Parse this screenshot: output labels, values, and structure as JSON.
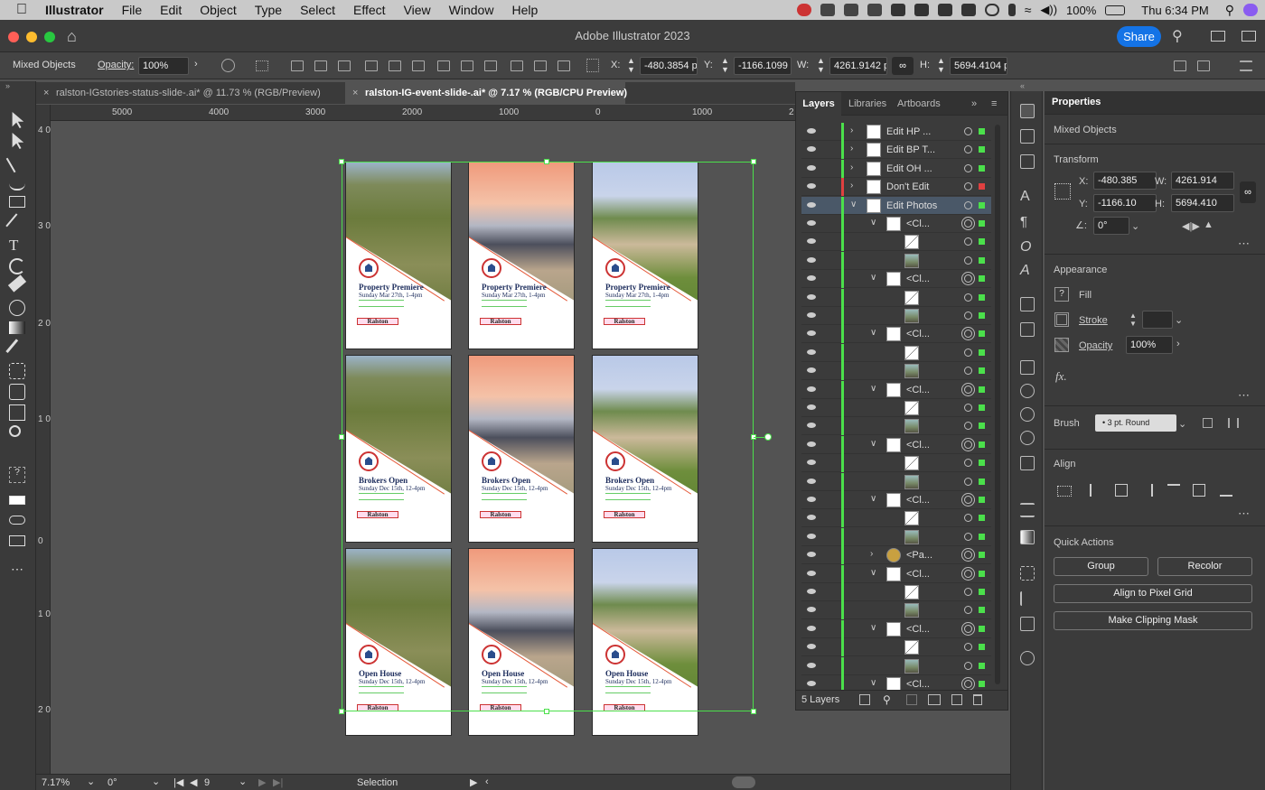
{
  "menubar": {
    "app": "Illustrator",
    "items": [
      "File",
      "Edit",
      "Object",
      "Type",
      "Select",
      "Effect",
      "View",
      "Window",
      "Help"
    ],
    "battery": "100%",
    "clock": "Thu 6:34 PM"
  },
  "window": {
    "title": "Adobe Illustrator 2023",
    "share": "Share"
  },
  "control": {
    "selection_type": "Mixed Objects",
    "opacity_label": "Opacity:",
    "opacity": "100%",
    "x_label": "X:",
    "x": "-480.3854 p",
    "y_label": "Y:",
    "y": "-1166.1099",
    "w_label": "W:",
    "w": "4261.9142 p",
    "h_label": "H:",
    "h": "5694.4104 p"
  },
  "tabs": [
    {
      "label": "ralston-IGstories-status-slide-.ai* @ 11.73 % (RGB/Preview)"
    },
    {
      "label": "ralston-IG-event-slide-.ai* @ 7.17 % (RGB/CPU Preview)"
    }
  ],
  "ruler": {
    "top": [
      "5000",
      "4000",
      "3000",
      "2000",
      "1000",
      "0",
      "1000",
      "2"
    ],
    "left": [
      "4 0 0",
      "3 0 0 0",
      "2 0 0 0",
      "1 0 0 0",
      "0",
      "1 0 0 0",
      "2 0 0 0"
    ]
  },
  "artboards": [
    {
      "title": "Property Premiere",
      "date": "Sunday Mar 27th, 1-4pm",
      "logo": "Ralston",
      "scene": "aerial"
    },
    {
      "title": "Property Premiere",
      "date": "Sunday Mar 27th, 1-4pm",
      "logo": "Ralston",
      "scene": "sunset"
    },
    {
      "title": "Property Premiere",
      "date": "Sunday Mar 27th, 1-4pm",
      "logo": "Ralston",
      "scene": "day"
    },
    {
      "title": "Brokers Open",
      "date": "Sunday Dec 15th, 12-4pm",
      "logo": "Ralston",
      "scene": "aerial"
    },
    {
      "title": "Brokers Open",
      "date": "Sunday Dec 15th, 12-4pm",
      "logo": "Ralston",
      "scene": "sunset"
    },
    {
      "title": "Brokers Open",
      "date": "Sunday Dec 15th, 12-4pm",
      "logo": "Ralston",
      "scene": "day"
    },
    {
      "title": "Open House",
      "date": "Sunday Dec 15th, 12-4pm",
      "logo": "Ralston",
      "scene": "aerial"
    },
    {
      "title": "Open House",
      "date": "Sunday Dec 15th, 12-4pm",
      "logo": "Ralston",
      "scene": "sunset"
    },
    {
      "title": "Open House",
      "date": "Sunday Dec 15th, 12-4pm",
      "logo": "Ralston",
      "scene": "day"
    }
  ],
  "layers_panel": {
    "tabs": [
      "Layers",
      "Libraries",
      "Artboards"
    ],
    "rows": [
      {
        "name": "Edit HP ...",
        "level": 0,
        "color": "#4be04b",
        "thumb": "doc"
      },
      {
        "name": "Edit BP T...",
        "level": 0,
        "color": "#4be04b",
        "thumb": "doc"
      },
      {
        "name": "Edit OH ...",
        "level": 0,
        "color": "#4be04b",
        "thumb": "doc"
      },
      {
        "name": "Don't Edit",
        "level": 0,
        "color": "#e04040",
        "thumb": "doc"
      },
      {
        "name": "Edit Photos",
        "level": 0,
        "color": "#4be04b",
        "thumb": "doc",
        "expanded": true,
        "selected": true
      },
      {
        "name": "<Cl...",
        "level": 1,
        "color": "#4be04b",
        "thumb": "clip",
        "expanded": true
      },
      {
        "name": "",
        "level": 2,
        "color": "#4be04b",
        "thumb": "path"
      },
      {
        "name": "",
        "level": 2,
        "color": "#4be04b",
        "thumb": "img"
      },
      {
        "name": "<Cl...",
        "level": 1,
        "color": "#4be04b",
        "thumb": "clip",
        "expanded": true
      },
      {
        "name": "",
        "level": 2,
        "color": "#4be04b",
        "thumb": "path"
      },
      {
        "name": "",
        "level": 2,
        "color": "#4be04b",
        "thumb": "img"
      },
      {
        "name": "<Cl...",
        "level": 1,
        "color": "#4be04b",
        "thumb": "clip",
        "expanded": true
      },
      {
        "name": "",
        "level": 2,
        "color": "#4be04b",
        "thumb": "path"
      },
      {
        "name": "",
        "level": 2,
        "color": "#4be04b",
        "thumb": "img"
      },
      {
        "name": "<Cl...",
        "level": 1,
        "color": "#4be04b",
        "thumb": "clip",
        "expanded": true
      },
      {
        "name": "",
        "level": 2,
        "color": "#4be04b",
        "thumb": "path"
      },
      {
        "name": "",
        "level": 2,
        "color": "#4be04b",
        "thumb": "img"
      },
      {
        "name": "<Cl...",
        "level": 1,
        "color": "#4be04b",
        "thumb": "clip",
        "expanded": true
      },
      {
        "name": "",
        "level": 2,
        "color": "#4be04b",
        "thumb": "path"
      },
      {
        "name": "",
        "level": 2,
        "color": "#4be04b",
        "thumb": "img"
      },
      {
        "name": "<Cl...",
        "level": 1,
        "color": "#4be04b",
        "thumb": "clip",
        "expanded": true
      },
      {
        "name": "",
        "level": 2,
        "color": "#4be04b",
        "thumb": "path"
      },
      {
        "name": "",
        "level": 2,
        "color": "#4be04b",
        "thumb": "img"
      },
      {
        "name": "<Pa...",
        "level": 1,
        "color": "#4be04b",
        "thumb": "gold"
      },
      {
        "name": "<Cl...",
        "level": 1,
        "color": "#4be04b",
        "thumb": "clip",
        "expanded": true
      },
      {
        "name": "",
        "level": 2,
        "color": "#4be04b",
        "thumb": "path"
      },
      {
        "name": "",
        "level": 2,
        "color": "#4be04b",
        "thumb": "img"
      },
      {
        "name": "<Cl...",
        "level": 1,
        "color": "#4be04b",
        "thumb": "clip",
        "expanded": true
      },
      {
        "name": "",
        "level": 2,
        "color": "#4be04b",
        "thumb": "path"
      },
      {
        "name": "",
        "level": 2,
        "color": "#4be04b",
        "thumb": "img"
      },
      {
        "name": "<Cl...",
        "level": 1,
        "color": "#4be04b",
        "thumb": "clip",
        "expanded": true
      }
    ],
    "footer": "5 Layers"
  },
  "properties": {
    "title": "Properties",
    "selection": "Mixed Objects",
    "transform": {
      "label": "Transform",
      "x": "-480.385",
      "y": "-1166.10",
      "w": "4261.914",
      "h": "5694.410",
      "angle": "0°"
    },
    "appearance": {
      "label": "Appearance",
      "fill": "Fill",
      "stroke": "Stroke",
      "opacity_label": "Opacity",
      "opacity": "100%",
      "fx": "fx."
    },
    "brush": {
      "label": "Brush",
      "value": "3 pt. Round"
    },
    "align": {
      "label": "Align"
    },
    "quick_actions": {
      "label": "Quick Actions",
      "group": "Group",
      "recolor": "Recolor",
      "pixel_grid": "Align to Pixel Grid",
      "clip_mask": "Make Clipping Mask"
    }
  },
  "status": {
    "zoom": "7.17%",
    "rotation": "0°",
    "artboard": "9",
    "tool": "Selection"
  },
  "colors": {
    "accent": "#1473e6",
    "selection": "#4be04b",
    "layer_red": "#e04040",
    "navy": "#1c2c5c"
  }
}
